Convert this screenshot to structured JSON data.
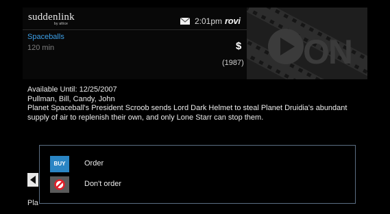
{
  "brand": {
    "logo": "suddenlink",
    "logo_sub": "by altice"
  },
  "status": {
    "time": "2:01pm",
    "provider_logo": "rovi",
    "mail_icon": "mail-icon"
  },
  "program": {
    "title": "Spaceballs",
    "duration": "120 min",
    "price": "$",
    "year": "(1987)",
    "available": "Available Until: 12/25/2007",
    "cast": "Pullman, Bill, Candy, John",
    "synopsis_line1": "Planet Spaceball's President Scroob sends Lord Dark Helmet to steal Planet Druidia's abundant",
    "synopsis_line2": "supply of air to replenish their own, and only Lone Starr can stop them."
  },
  "poster": {
    "text": "ON",
    "icon": "on-demand-play-icon"
  },
  "background": {
    "partial_label": "Pla"
  },
  "dialog": {
    "options": [
      {
        "icon_text": "BUY",
        "label": "Order",
        "icon": "buy-icon"
      },
      {
        "icon_text": "",
        "label": "Don't order",
        "icon": "prohibited-icon"
      }
    ]
  },
  "colors": {
    "accent": "#3da0e8",
    "buy": "#2a85c4",
    "dialog_border": "#5c6f84",
    "prohibited": "#e0202a"
  }
}
